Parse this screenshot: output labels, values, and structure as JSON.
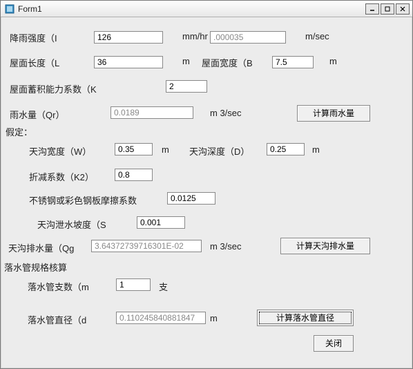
{
  "window": {
    "title": "Form1"
  },
  "labels": {
    "rain_intensity": "降雨强度（I",
    "mm_hr": "mm/hr",
    "m_sec": "m/sec",
    "roof_length": "屋面长度（L",
    "m_unit": "m",
    "roof_width": "屋面宽度（B",
    "roof_storage": "屋面蓄积能力系数（K",
    "rain_volume": "雨水量（Qr）",
    "m3_sec": "m 3/sec",
    "assume": "假定：",
    "gutter_width": "天沟宽度（W）",
    "gutter_depth": "天沟深度（D）",
    "reduce_coef": "折减系数（K2）",
    "friction_coef": "不锈钢或彩色钢板摩擦系数",
    "slope": "天沟泄水坡度（S",
    "gutter_drain": "天沟排水量（Qg",
    "pipe_spec": "落水管规格核算",
    "pipe_count": "落水管支数（m",
    "pipe_count_unit": "支",
    "pipe_diameter": "落水管直径（d"
  },
  "inputs": {
    "rain_intensity": "126",
    "rain_intensity_ms": ".000035",
    "roof_length": "36",
    "roof_width": "7.5",
    "storage_coef": "2",
    "rain_volume": "0.0189",
    "gutter_width": "0.35",
    "gutter_depth": "0.25",
    "reduce_coef": "0.8",
    "friction_coef": "0.0125",
    "slope": "0.001",
    "gutter_drain": "3.64372739716301E-02",
    "pipe_count": "1",
    "pipe_diameter": "0.110245840881847"
  },
  "buttons": {
    "calc_rain": "计算雨水量",
    "calc_gutter": "计算天沟排水量",
    "calc_pipe": "计算落水管直径",
    "close": "关闭"
  }
}
